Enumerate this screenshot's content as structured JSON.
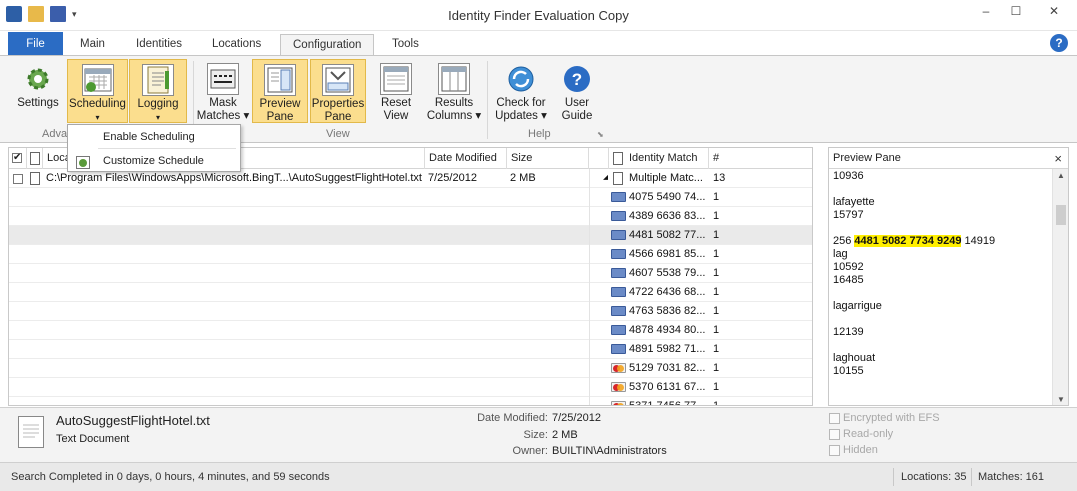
{
  "window": {
    "title": "Identity Finder Evaluation Copy"
  },
  "tabs": [
    "File",
    "Main",
    "Identities",
    "Locations",
    "Configuration",
    "Tools"
  ],
  "active_tab": "Configuration",
  "ribbon": {
    "buttons": {
      "settings": "Settings",
      "scheduling": "Scheduling",
      "logging": "Logging",
      "mask_matches": [
        "Mask",
        "Matches"
      ],
      "preview_pane": [
        "Preview",
        "Pane"
      ],
      "properties_pane": [
        "Properties",
        "Pane"
      ],
      "reset_view": [
        "Reset",
        "View"
      ],
      "results_columns": [
        "Results",
        "Columns"
      ],
      "check_updates": [
        "Check for",
        "Updates"
      ],
      "user_guide": [
        "User",
        "Guide"
      ]
    },
    "groups": {
      "advanced": "Adva",
      "view": "View",
      "help": "Help"
    }
  },
  "scheduling_menu": [
    "Enable Scheduling",
    "Customize Schedule"
  ],
  "grid": {
    "headers": {
      "location": "Loca",
      "date_modified": "Date Modified",
      "size": "Size",
      "identity_match": "Identity Match",
      "count": "#"
    },
    "file_row": {
      "path": "C:\\Program Files\\WindowsApps\\Microsoft.BingT...\\AutoSuggestFlightHotel.txt",
      "date": "7/25/2012",
      "size": "2 MB",
      "match": "Multiple Matc...",
      "count": "13"
    },
    "matches": [
      {
        "value": "4075 5490 74...",
        "count": "1",
        "card": "visa"
      },
      {
        "value": "4389 6636 83...",
        "count": "1",
        "card": "visa"
      },
      {
        "value": "4481 5082 77...",
        "count": "1",
        "card": "visa"
      },
      {
        "value": "4566 6981 85...",
        "count": "1",
        "card": "visa"
      },
      {
        "value": "4607 5538 79...",
        "count": "1",
        "card": "visa"
      },
      {
        "value": "4722 6436 68...",
        "count": "1",
        "card": "visa"
      },
      {
        "value": "4763 5836 82...",
        "count": "1",
        "card": "visa"
      },
      {
        "value": "4878 4934 80...",
        "count": "1",
        "card": "visa"
      },
      {
        "value": "4891 5982 71...",
        "count": "1",
        "card": "visa"
      },
      {
        "value": "5129 7031 82...",
        "count": "1",
        "card": "mastercard"
      },
      {
        "value": "5370 6131 67...",
        "count": "1",
        "card": "mastercard"
      },
      {
        "value": "5371 7456 77...",
        "count": "1",
        "card": "mastercard"
      }
    ]
  },
  "preview": {
    "title": "Preview Pane",
    "close": "×",
    "lines": [
      "10936",
      "",
      "lafayette",
      "15797",
      "",
      "",
      "lag",
      "10592",
      "16485",
      "",
      "lagarrigue",
      "",
      "12139",
      "",
      "laghouat",
      "10155"
    ],
    "hl_line": {
      "prefix": "256 ",
      "highlight": "4481 5082 7734 9249",
      "suffix": " 14919"
    }
  },
  "details": {
    "file_name": "AutoSuggestFlightHotel.txt",
    "file_type": "Text Document",
    "date_modified_label": "Date Modified:",
    "date_modified": "7/25/2012",
    "size_label": "Size:",
    "size": "2 MB",
    "owner_label": "Owner:",
    "owner": "BUILTIN\\Administrators",
    "checkboxes": [
      "Encrypted with EFS",
      "Read-only",
      "Hidden"
    ]
  },
  "status": {
    "message": "Search Completed in 0 days, 0 hours, 4 minutes, and 59 seconds",
    "locations": "Locations: 35",
    "matches": "Matches: 161"
  },
  "colors": {
    "accent": "#2b6cc4",
    "highlight": "#ffef00",
    "ribbon_selected": "#fbde8e"
  }
}
